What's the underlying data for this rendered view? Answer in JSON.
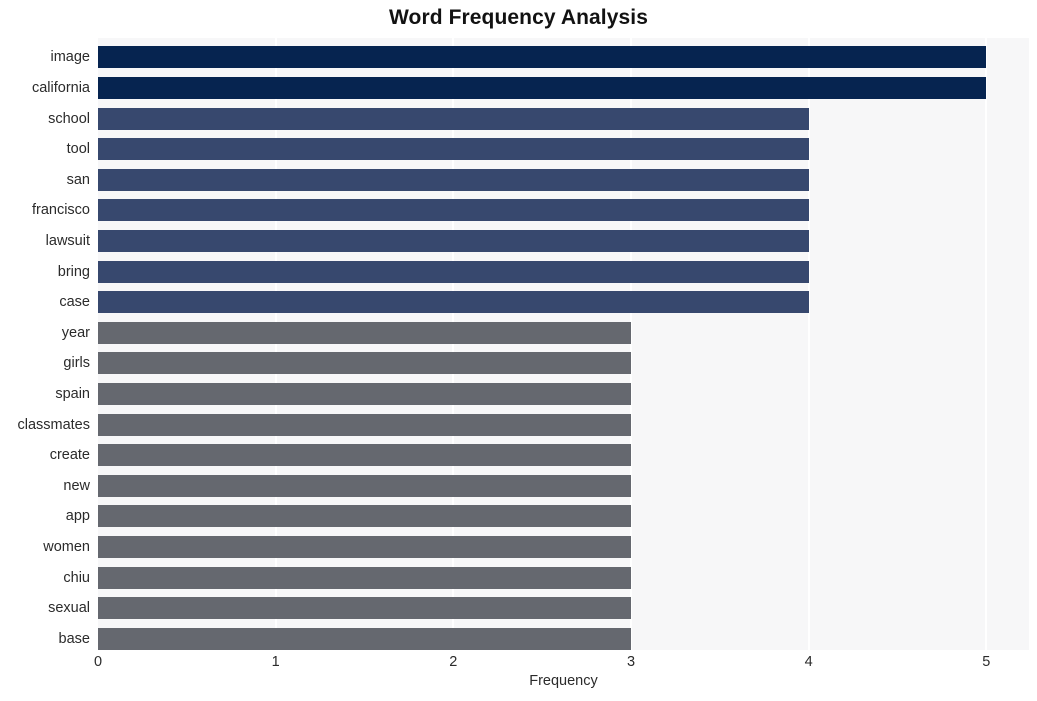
{
  "chart_data": {
    "type": "bar",
    "orientation": "horizontal",
    "title": "Word Frequency Analysis",
    "xlabel": "Frequency",
    "ylabel": "",
    "xlim": [
      0,
      5.24
    ],
    "xticks": [
      0,
      1,
      2,
      3,
      4,
      5
    ],
    "xtick_labels": [
      "0",
      "1",
      "2",
      "3",
      "4",
      "5"
    ],
    "grid": true,
    "grid_axis": "x",
    "legend": null,
    "categories": [
      "image",
      "california",
      "school",
      "tool",
      "san",
      "francisco",
      "lawsuit",
      "bring",
      "case",
      "year",
      "girls",
      "spain",
      "classmates",
      "create",
      "new",
      "app",
      "women",
      "chiu",
      "sexual",
      "base"
    ],
    "values": [
      5,
      5,
      4,
      4,
      4,
      4,
      4,
      4,
      4,
      3,
      3,
      3,
      3,
      3,
      3,
      3,
      3,
      3,
      3,
      3
    ],
    "bar_colors": [
      "#062450",
      "#062450",
      "#37486e",
      "#37486e",
      "#37486e",
      "#37486e",
      "#37486e",
      "#37486e",
      "#37486e",
      "#65686f",
      "#65686f",
      "#65686f",
      "#65686f",
      "#65686f",
      "#65686f",
      "#65686f",
      "#65686f",
      "#65686f",
      "#65686f",
      "#65686f"
    ],
    "plot_background": "#f7f7f8",
    "figure_background": "#ffffff",
    "gridline_color": "#ffffff"
  }
}
